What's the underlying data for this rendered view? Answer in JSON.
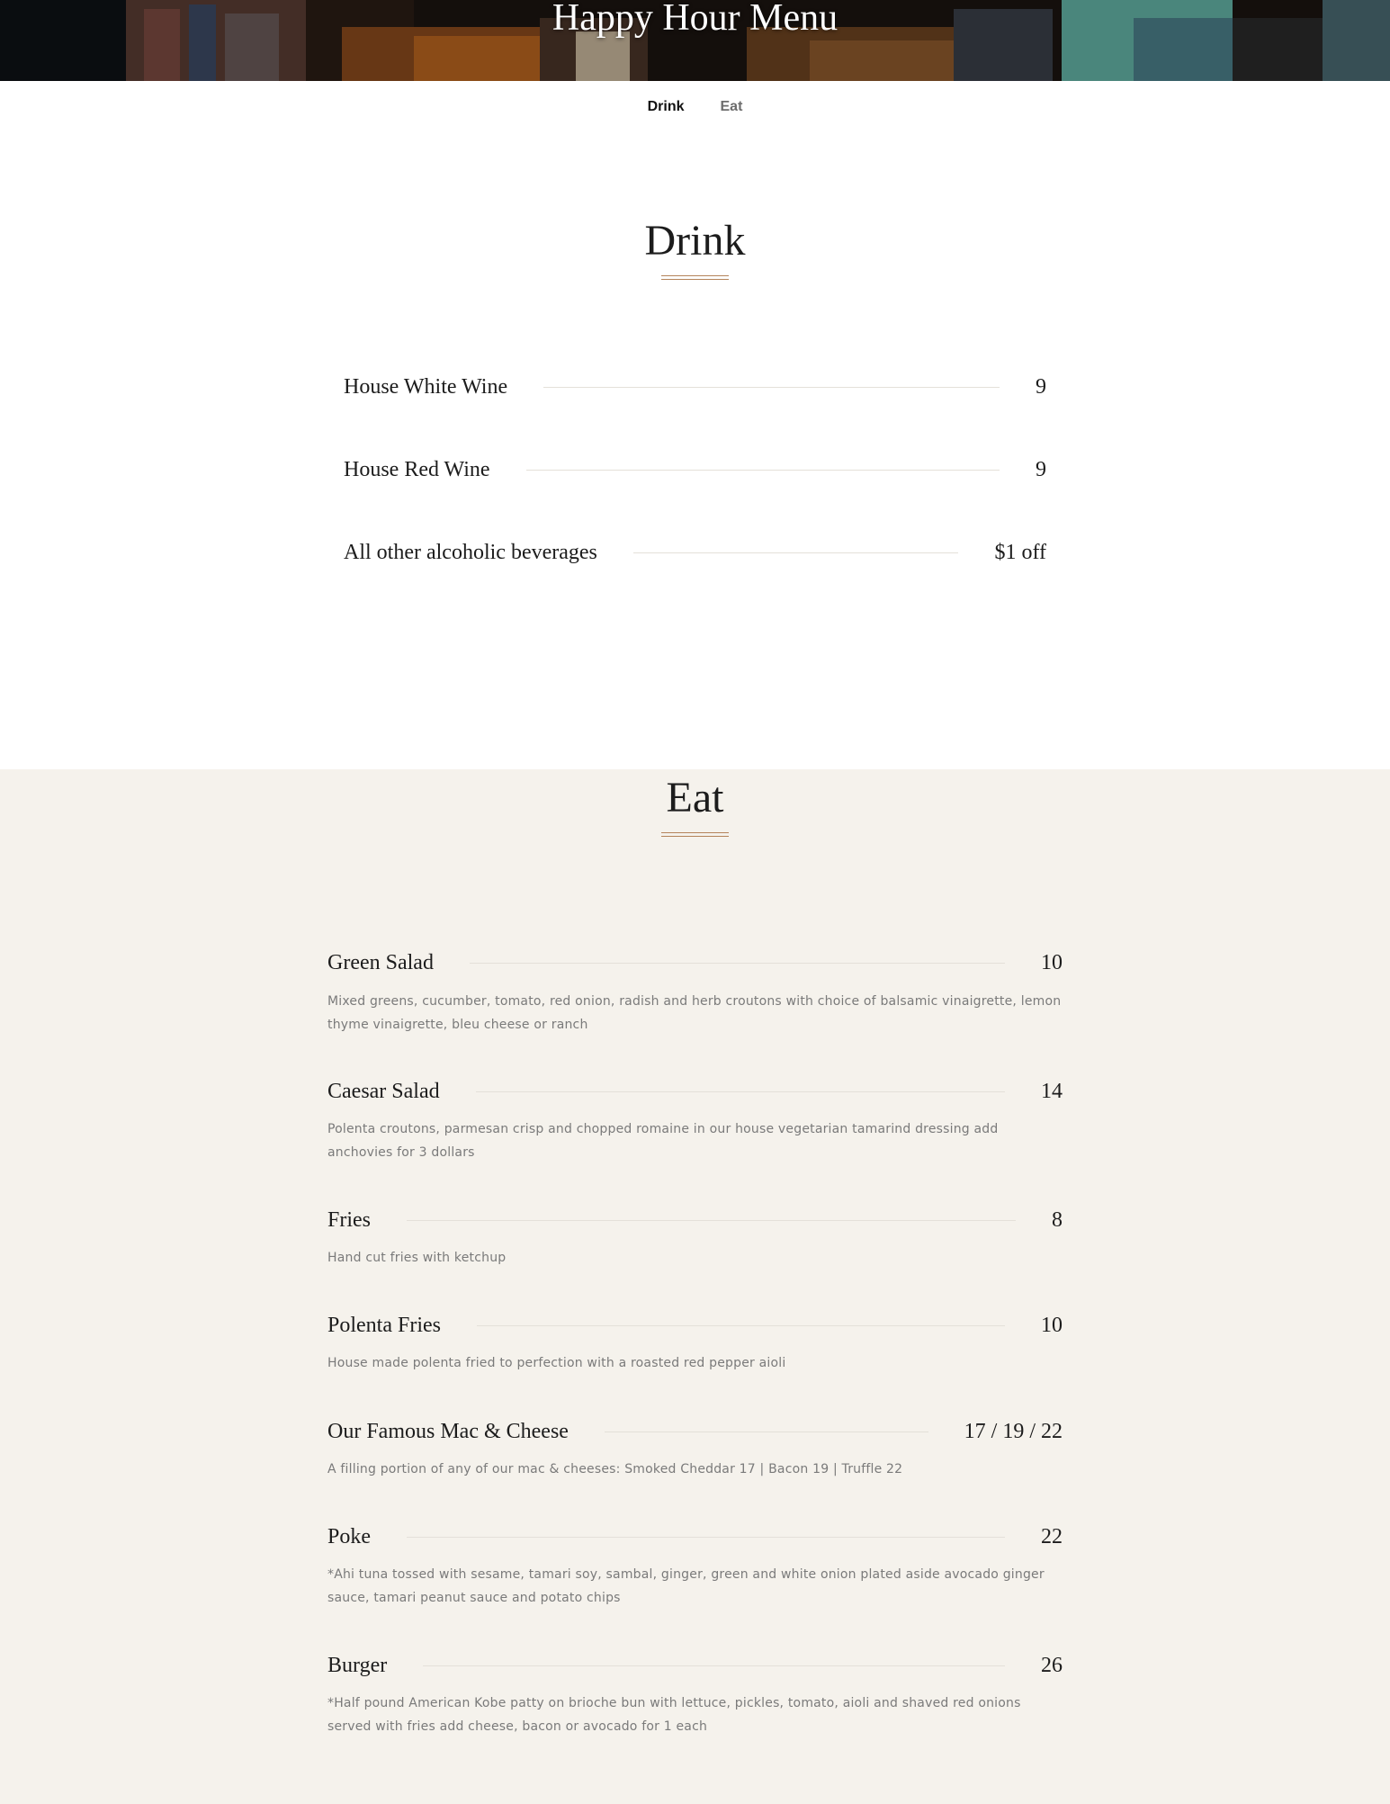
{
  "header": {
    "title": "Happy Hour Menu"
  },
  "tabs": [
    {
      "label": "Drink",
      "active": true
    },
    {
      "label": "Eat",
      "active": false
    }
  ],
  "drink": {
    "title": "Drink",
    "items": [
      {
        "name": "House White Wine",
        "price": "9"
      },
      {
        "name": "House Red Wine",
        "price": "9"
      },
      {
        "name": "All other alcoholic beverages",
        "price": "$1 off"
      }
    ]
  },
  "eat": {
    "title": "Eat",
    "items": [
      {
        "name": "Green Salad",
        "price": "10",
        "description": "Mixed greens, cucumber, tomato, red onion, radish and herb croutons with choice of balsamic vinaigrette, lemon thyme vinaigrette, bleu cheese or ranch"
      },
      {
        "name": "Caesar Salad",
        "price": "14",
        "description": "Polenta croutons, parmesan crisp and chopped romaine in our house vegetarian tamarind dressing add anchovies for 3 dollars"
      },
      {
        "name": "Fries",
        "price": "8",
        "description": "Hand cut fries with ketchup"
      },
      {
        "name": "Polenta Fries",
        "price": "10",
        "description": "House made polenta fried to perfection with a roasted red pepper aioli"
      },
      {
        "name": "Our Famous Mac & Cheese",
        "price": "17 / 19 / 22",
        "description": "A filling portion of any of our mac & cheeses: Smoked Cheddar 17 | Bacon 19 | Truffle 22"
      },
      {
        "name": "Poke",
        "price": "22",
        "description": "*Ahi tuna tossed with sesame, tamari soy, sambal, ginger, green and white onion plated aside avocado ginger sauce, tamari peanut sauce and potato chips"
      },
      {
        "name": "Burger",
        "price": "26",
        "description": "*Half pound American Kobe patty on brioche bun with lettuce, pickles, tomato, aioli and shaved red onions served with fries add cheese, bacon or avocado for 1 each"
      }
    ]
  },
  "colors": {
    "accent": "#b4835a",
    "eat_background": "#f5f2ec",
    "description_text": "#7a7a7a"
  }
}
